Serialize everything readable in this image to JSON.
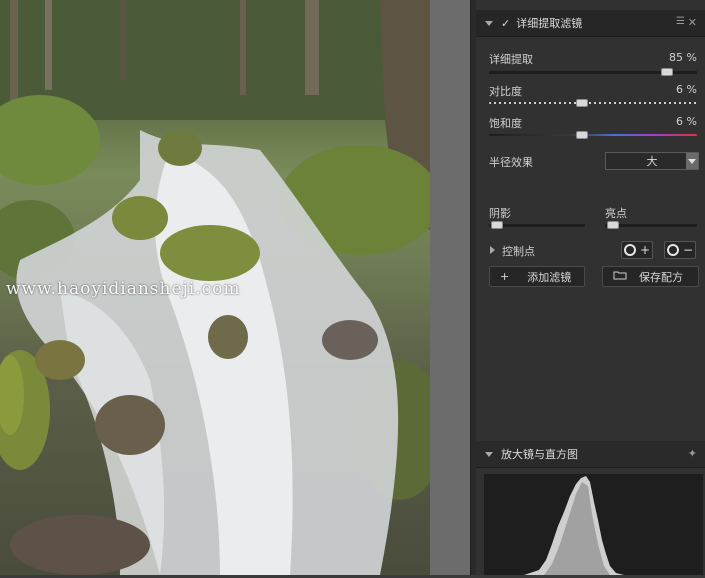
{
  "watermark": "www.haoyidiansheji.com",
  "filter_panel": {
    "title": "详细提取滤镜",
    "check_mark": "✓",
    "menu_icon": "list-menu-icon",
    "close_icon": "close-icon",
    "sliders": [
      {
        "label": "详细提取",
        "value_text": "85 %",
        "value": 85
      },
      {
        "label": "对比度",
        "value_text": "6 %",
        "value": 6
      },
      {
        "label": "饱和度",
        "value_text": "6 %",
        "value": 6
      }
    ],
    "radius": {
      "label": "半径效果",
      "selected": "大"
    },
    "shadow_label": "阴影",
    "highlight_label": "亮点",
    "control_points_label": "控制点",
    "add_cp_symbol": "+",
    "remove_cp_symbol": "−",
    "add_filter_label": "添加滤镜",
    "add_filter_icon": "+",
    "save_recipe_label": "保存配方",
    "save_recipe_icon": "folder-icon"
  },
  "loupe_panel": {
    "title": "放大镜与直方图",
    "pin_icon": "pin-icon"
  },
  "colors": {
    "panel_bg": "#313131",
    "header_bg": "#262626",
    "histogram_bg": "#1e1e1e"
  }
}
